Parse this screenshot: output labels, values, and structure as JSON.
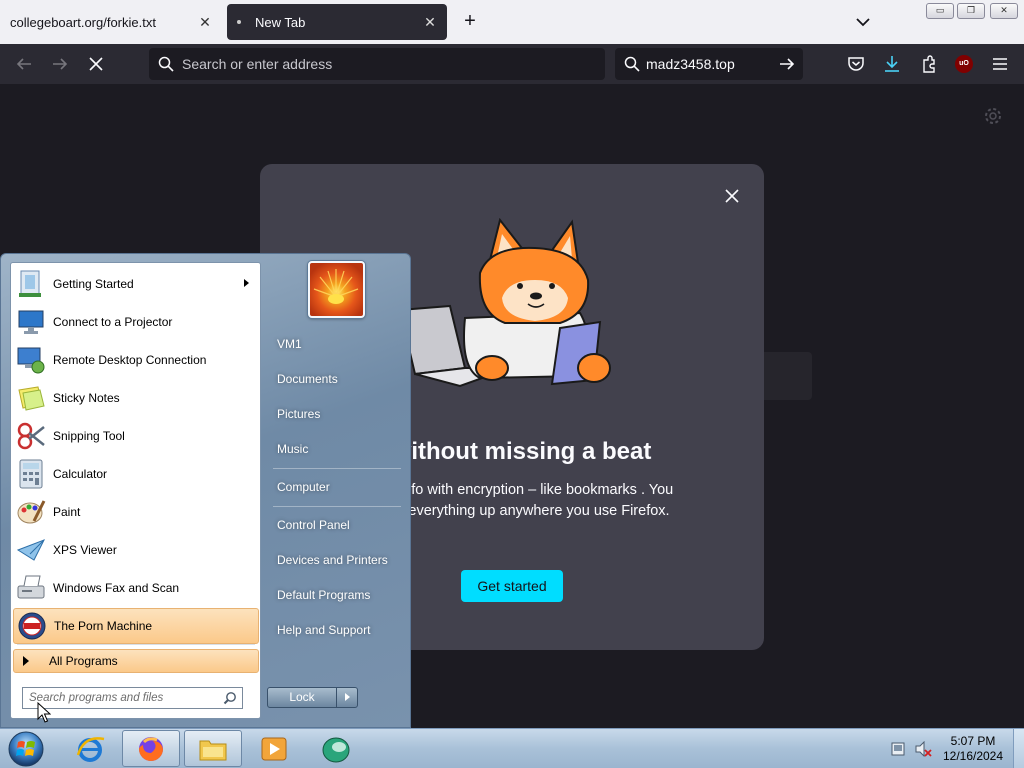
{
  "browser": {
    "tabs": [
      {
        "label": "collegeboart.org/forkie.txt",
        "active": false
      },
      {
        "label": "New Tab",
        "active": true
      }
    ],
    "address_placeholder": "Search or enter address",
    "search_engine_query": "madz3458.top",
    "ublock_badge": "uO"
  },
  "dialog": {
    "title": "e without missing a beat",
    "body": "portant info with encryption – like bookmarks . You can pull everything up anywhere you use Firefox.",
    "cta": "Get started"
  },
  "start_menu": {
    "programs": [
      {
        "label": "Getting Started",
        "icon": "getting-started-icon",
        "has_submenu": true
      },
      {
        "label": "Connect to a Projector",
        "icon": "projector-icon"
      },
      {
        "label": "Remote Desktop Connection",
        "icon": "remote-desktop-icon"
      },
      {
        "label": "Sticky Notes",
        "icon": "sticky-notes-icon"
      },
      {
        "label": "Snipping Tool",
        "icon": "snipping-tool-icon"
      },
      {
        "label": "Calculator",
        "icon": "calculator-icon"
      },
      {
        "label": "Paint",
        "icon": "paint-icon"
      },
      {
        "label": "XPS Viewer",
        "icon": "xps-viewer-icon"
      },
      {
        "label": "Windows Fax and Scan",
        "icon": "fax-scan-icon"
      },
      {
        "label": "The Porn Machine",
        "icon": "porn-machine-icon",
        "highlighted": true
      }
    ],
    "all_programs": "All Programs",
    "search_placeholder": "Search programs and files",
    "right_links": [
      "VM1",
      "Documents",
      "Pictures",
      "Music",
      "Computer",
      "Control Panel",
      "Devices and Printers",
      "Default Programs",
      "Help and Support"
    ],
    "lock": "Lock"
  },
  "taskbar": {
    "items": [
      "internet-explorer-icon",
      "firefox-icon",
      "file-explorer-icon",
      "media-player-icon",
      "app-icon"
    ],
    "clock_time": "5:07 PM",
    "clock_date": "12/16/2024"
  },
  "colors": {
    "browser_dark": "#1c1b22",
    "toolbar": "#2b2a33",
    "dialog_bg": "#42414d",
    "accent": "#00ddff",
    "highlight": "#fbc98a"
  }
}
